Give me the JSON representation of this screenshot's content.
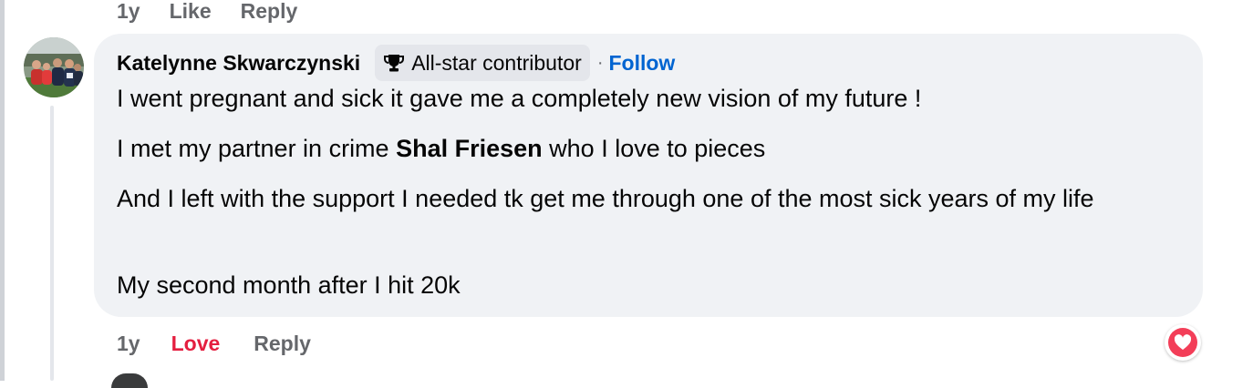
{
  "previous_comment": {
    "time": "1y",
    "like_label": "Like",
    "reply_label": "Reply"
  },
  "comment": {
    "author": "Katelynne Skwarczynski",
    "badge_label": "All-star contributor",
    "badge_icon": "trophy-icon",
    "separator": "·",
    "follow_label": "Follow",
    "paragraphs": {
      "p1": "I went pregnant and sick it gave me a completely new vision of my future !",
      "p2_before": "I met my partner in crime ",
      "p2_mention": "Shal Friesen",
      "p2_after": " who I love to pieces",
      "p3": "And I left with the support I needed tk get me through one of the most sick years of my life",
      "p4": "My second month after I hit 20k"
    },
    "time": "1y",
    "reaction_label": "Love",
    "reply_label": "Reply",
    "reaction_icon": "heart-reaction-icon"
  },
  "colors": {
    "bubble": "#f0f2f5",
    "link_blue": "#0064d1",
    "love_red": "#e41e3f",
    "heart_pink": "#f33e58",
    "muted": "#65676b"
  }
}
